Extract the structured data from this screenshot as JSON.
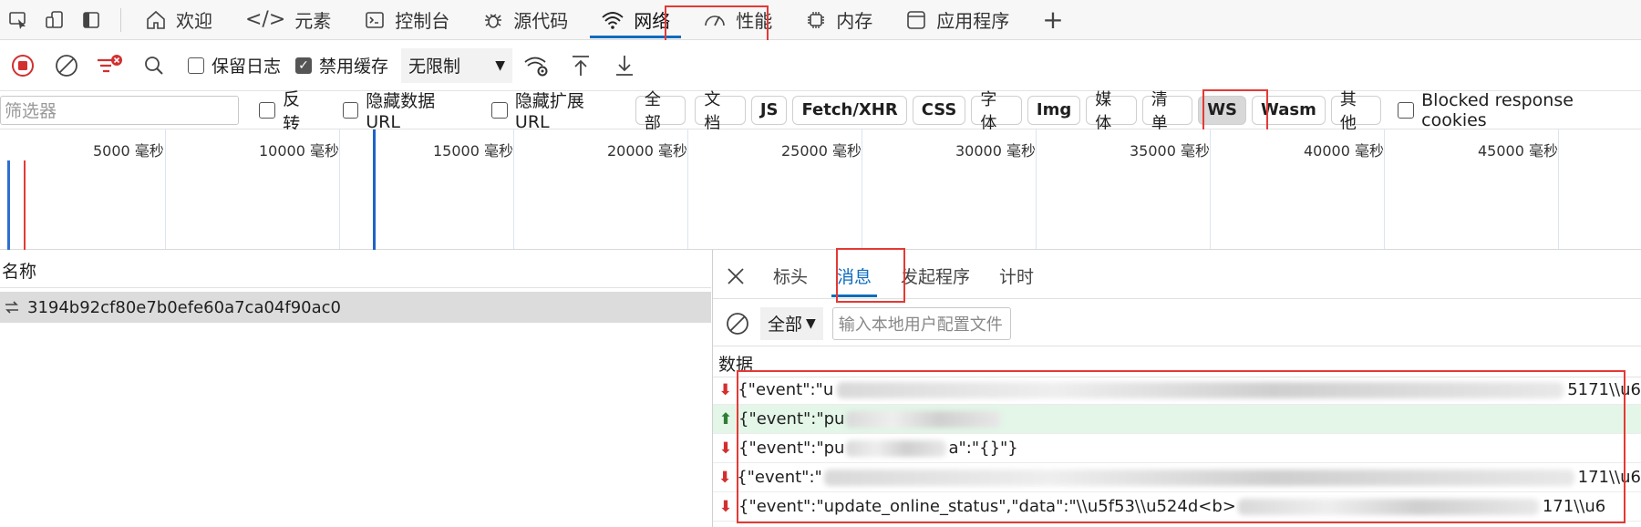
{
  "tabs": [
    {
      "label": "欢迎",
      "icon": "home-icon"
    },
    {
      "label": "元素",
      "icon": "code-icon"
    },
    {
      "label": "控制台",
      "icon": "console-icon"
    },
    {
      "label": "源代码",
      "icon": "bug-icon"
    },
    {
      "label": "网络",
      "icon": "wifi-icon",
      "active": true
    },
    {
      "label": "性能",
      "icon": "gauge-icon"
    },
    {
      "label": "内存",
      "icon": "chip-icon"
    },
    {
      "label": "应用程序",
      "icon": "app-icon"
    }
  ],
  "add_tab_label": "+",
  "toolbar": {
    "preserve_log": "保留日志",
    "disable_cache": "禁用缓存",
    "throttle": "无限制"
  },
  "filters": {
    "placeholder": "筛选器",
    "invert": "反转",
    "hide_data_url": "隐藏数据 URL",
    "hide_ext_url": "隐藏扩展 URL",
    "chips": [
      "全部",
      "文档",
      "JS",
      "Fetch/XHR",
      "CSS",
      "字体",
      "Img",
      "媒体",
      "清单",
      "WS",
      "Wasm",
      "其他"
    ],
    "blocked_cookies": "Blocked response cookies"
  },
  "timeline": {
    "labels": [
      "5000 毫秒",
      "10000 毫秒",
      "15000 毫秒",
      "20000 毫秒",
      "25000 毫秒",
      "30000 毫秒",
      "35000 毫秒",
      "40000 毫秒",
      "45000 毫秒"
    ]
  },
  "left": {
    "name_header": "名称",
    "request_name": "3194b92cf80e7b0efe60a7ca04f90ac0"
  },
  "right": {
    "tabs": [
      "标头",
      "消息",
      "发起程序",
      "计时"
    ],
    "active_tab": "消息",
    "filter_all": "全部",
    "filter_placeholder": "输入本地用户配置文件",
    "data_header": "数据",
    "messages": [
      {
        "dir": "down",
        "prefix": "{\"event\":\"u",
        "suffix": "5171\\\\u6"
      },
      {
        "dir": "up",
        "prefix": "{\"event\":\"pu",
        "suffix": ""
      },
      {
        "dir": "down",
        "prefix": "{\"event\":\"pu",
        "suffix": "a\":\"{}\"}"
      },
      {
        "dir": "down",
        "prefix": "{\"event\":\"",
        "suffix": "171\\\\u6"
      },
      {
        "dir": "down",
        "prefix": "{\"event\":\"update_online_status\",\"data\":\"\\\\u5f53\\\\u524d<b>",
        "suffix": "171\\\\u6"
      }
    ]
  },
  "colors": {
    "accent": "#0f6cbd",
    "highlight": "#e53935",
    "record": "#d32f2f"
  }
}
